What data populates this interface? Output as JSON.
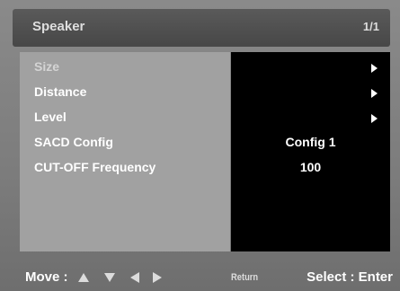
{
  "header": {
    "title": "Speaker",
    "page": "1/1"
  },
  "menu": {
    "items": [
      {
        "label": "Size",
        "value": "",
        "has_submenu": true,
        "dim": true
      },
      {
        "label": "Distance",
        "value": "",
        "has_submenu": true,
        "dim": false
      },
      {
        "label": "Level",
        "value": "",
        "has_submenu": true,
        "dim": false
      },
      {
        "label": "SACD Config",
        "value": "Config  1",
        "has_submenu": false,
        "dim": false
      },
      {
        "label": "CUT-OFF Frequency",
        "value": "100",
        "has_submenu": false,
        "dim": false
      }
    ]
  },
  "footer": {
    "move_label": "Move :",
    "return_label": "Return",
    "select_label": "Select : Enter"
  },
  "colors": {
    "background": "#7c7c7c",
    "header": "#4e4e4e",
    "left_panel": "#a1a1a1",
    "right_panel": "#000000",
    "text": "#ffffff"
  }
}
